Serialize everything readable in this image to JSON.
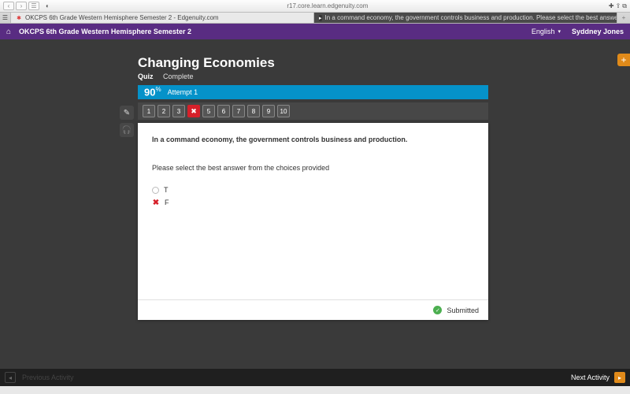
{
  "browser": {
    "url": "r17.core.learn.edgenuity.com",
    "tabs": [
      {
        "label": "OKCPS 6th Grade Western Hemisphere Semester 2 - Edgenuity.com"
      },
      {
        "label": "In a command economy, the government controls business and production. Please select the best answer - Brainly.com"
      }
    ]
  },
  "header": {
    "course": "OKCPS 6th Grade Western Hemisphere Semester 2",
    "language": "English",
    "user": "Syddney Jones"
  },
  "lesson": {
    "title": "Changing Economies",
    "type": "Quiz",
    "status": "Complete",
    "score_pct": "90",
    "score_suffix": "%",
    "attempt": "Attempt 1"
  },
  "question_nav": [
    "1",
    "2",
    "3",
    "",
    "5",
    "6",
    "7",
    "8",
    "9",
    "10"
  ],
  "question": {
    "text": "In a command economy, the government controls business and production.",
    "instruction": "Please select the best answer from the choices provided",
    "answers": [
      {
        "label": "T",
        "marked": false
      },
      {
        "label": "F",
        "marked": true
      }
    ],
    "submitted_label": "Submitted"
  },
  "bottom": {
    "prev_label": "Previous Activity",
    "next_label": "Next Activity"
  }
}
